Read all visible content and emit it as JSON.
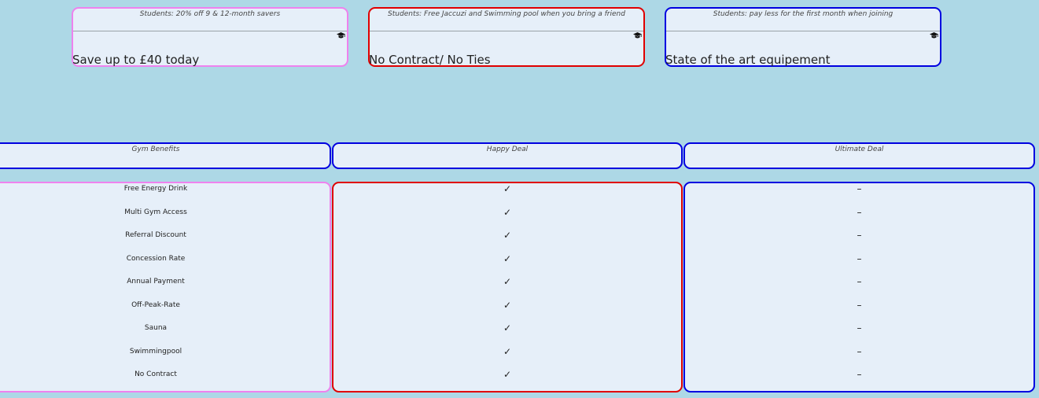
{
  "promos": [
    {
      "subtitle": "Students: 20% off 9 & 12-month savers",
      "headline": "Save up to £40 today",
      "icon": "graduation-cap-icon",
      "border": "#ee82ee"
    },
    {
      "subtitle": "Students: Free Jaccuzi and Swimming pool when you bring a friend",
      "headline": "No Contract/ No Ties",
      "icon": "graduation-cap-icon",
      "border": "#e00000"
    },
    {
      "subtitle": "Students: pay less for the first month when joining",
      "headline": "State of the art equipement",
      "icon": "graduation-cap-icon",
      "border": "#0000e0"
    }
  ],
  "table": {
    "columns": [
      "Gym Benefits",
      "Happy Deal",
      "Ultimate Deal"
    ],
    "benefits": [
      "Free Energy Drink",
      "Multi Gym Access",
      "Referral Discount",
      "Concession Rate",
      "Annual Payment",
      "Off-Peak-Rate",
      "Sauna",
      "Swimmingpool",
      "No Contract"
    ],
    "happy_deal": [
      "✓",
      "✓",
      "✓",
      "✓",
      "✓",
      "✓",
      "✓",
      "✓",
      "✓"
    ],
    "ultimate_deal": [
      "–",
      "–",
      "–",
      "–",
      "–",
      "–",
      "–",
      "–",
      "–"
    ]
  }
}
